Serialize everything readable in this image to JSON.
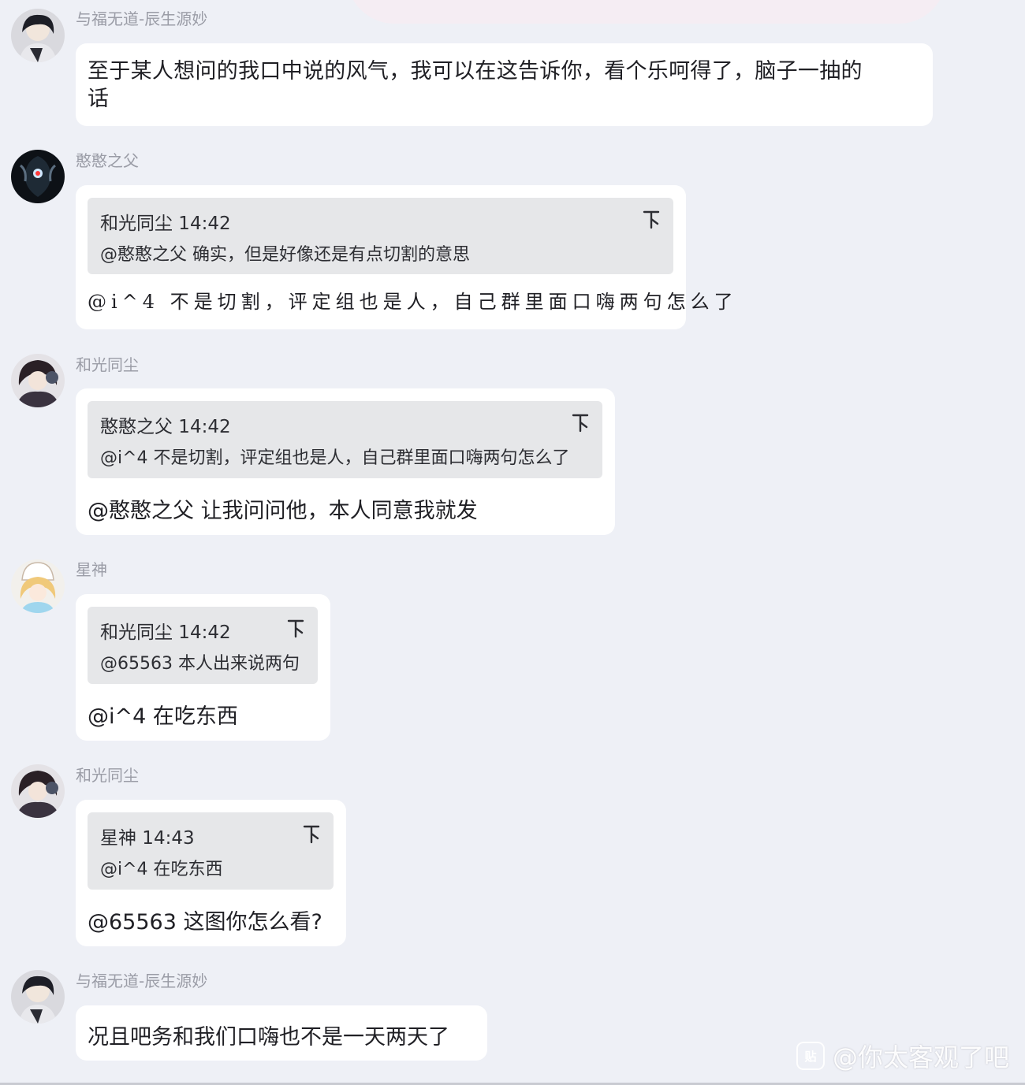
{
  "messages": [
    {
      "sender": "与福无道-辰生源妙",
      "text_line1": "至于某人想问的我口中说的风气，我可以在这告诉你，看个乐呵得了，脑子一抽的",
      "text_line2": "话"
    },
    {
      "sender": "憨憨之父",
      "quote_head": "和光同尘 14:42",
      "quote_body": "@憨憨之父 确实，但是好像还是有点切割的意思",
      "reply": "@i^4 不是切割，评定组也是人，自己群里面口嗨两句怎么了"
    },
    {
      "sender": "和光同尘",
      "quote_head": "憨憨之父 14:42",
      "quote_body": "@i^4 不是切割，评定组也是人，自己群里面口嗨两句怎么了",
      "reply": "@憨憨之父 让我问问他，本人同意我就发"
    },
    {
      "sender": "星神",
      "quote_head": "和光同尘 14:42",
      "quote_body": "@65563 本人出来说两句",
      "reply": "@i^4 在吃东西"
    },
    {
      "sender": "和光同尘",
      "quote_head": "星神 14:43",
      "quote_body": "@i^4 在吃东西",
      "reply": "@65563 这图你怎么看?"
    },
    {
      "sender": "与福无道-辰生源妙",
      "text": "况且吧务和我们口嗨也不是一天两天了"
    }
  ],
  "watermark": {
    "logo": "贴",
    "handle": "@你太客观了吧"
  },
  "colors": {
    "background": "#eef0f6",
    "bubble": "#ffffff",
    "quote": "#e6e7e9",
    "sender": "#9a9ca6"
  },
  "icons": {
    "quote_jump": "jump-to-quote-icon"
  }
}
